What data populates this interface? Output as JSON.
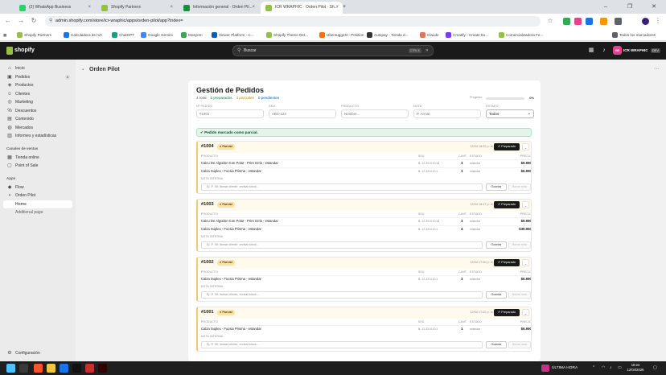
{
  "browser": {
    "tabs": [
      {
        "label": "(2) WhatsApp Business",
        "color": "#25d366"
      },
      {
        "label": "Shopify Partners",
        "color": "#95bf47"
      },
      {
        "label": "Información general · Orden Pil...",
        "color": "#1a8f3c"
      },
      {
        "label": "ICR WRAPHIC · Orden Pilot · Sh...",
        "color": "#95bf47"
      }
    ],
    "new_tab": "+",
    "url": "admin.shopify.com/store/icr-wraphic/apps/orden-pilot/app?index=",
    "bookmarks": [
      {
        "label": "Shopify Partners",
        "color": "#95bf47"
      },
      {
        "label": "Calculadora de IVA",
        "color": "#1a73e8"
      },
      {
        "label": "ChatGPT",
        "color": "#10a37f"
      },
      {
        "label": "Google Gemini",
        "color": "#4285f4"
      },
      {
        "label": "Mosyren",
        "color": "#34a853"
      },
      {
        "label": "Viewer Platform - A...",
        "color": "#0b5cad"
      },
      {
        "label": "Shopify Theme Det...",
        "color": "#95bf47"
      },
      {
        "label": "Ubersuggest - Position",
        "color": "#ff6f00"
      },
      {
        "label": "Autopay - Tienda d...",
        "color": "#333333"
      },
      {
        "label": "Claude",
        "color": "#d97757"
      },
      {
        "label": "Creatify - Create Ex...",
        "color": "#7c3aed"
      },
      {
        "label": "Comercializadora Fe...",
        "color": "#95bf47"
      }
    ],
    "all_bookmarks": "Todos los marcadores"
  },
  "topbar": {
    "logo": "shopify",
    "search_placeholder": "Buscar",
    "search_shortcut": "CTRL K",
    "store_initials": "IW",
    "store_name": "ICR WRAPHIC",
    "store_tag": "DEV"
  },
  "sidebar": {
    "items": [
      {
        "label": "Inicio",
        "icon": "home-icon",
        "glyph": "⌂"
      },
      {
        "label": "Pedidos",
        "icon": "inbox-icon",
        "glyph": "▣",
        "count": "4"
      },
      {
        "label": "Productos",
        "icon": "tag-icon",
        "glyph": "◈"
      },
      {
        "label": "Clientes",
        "icon": "person-icon",
        "glyph": "☺"
      },
      {
        "label": "Marketing",
        "icon": "target-icon",
        "glyph": "◎"
      },
      {
        "label": "Descuentos",
        "icon": "discount-icon",
        "glyph": "%"
      },
      {
        "label": "Contenido",
        "icon": "content-icon",
        "glyph": "▤"
      },
      {
        "label": "Mercados",
        "icon": "globe-icon",
        "glyph": "◍"
      },
      {
        "label": "Informes y estadísticas",
        "icon": "chart-icon",
        "glyph": "▥"
      }
    ],
    "channels_head": "Canales de ventas",
    "channels": [
      {
        "label": "Tienda online",
        "icon": "store-icon",
        "glyph": "▦"
      },
      {
        "label": "Point of Sale",
        "icon": "pos-icon",
        "glyph": "▢"
      }
    ],
    "apps_head": "Apps",
    "apps": [
      {
        "label": "Flow",
        "icon": "flow-icon",
        "glyph": "◆"
      },
      {
        "label": "Orden Pilot",
        "icon": "app-icon",
        "glyph": "▪"
      }
    ],
    "app_sub": [
      {
        "label": "Home"
      },
      {
        "label": "Additional page"
      }
    ],
    "settings": {
      "label": "Configuración",
      "icon": "gear-icon",
      "glyph": "⚙"
    }
  },
  "app": {
    "title": "Orden Pilot",
    "heading": "Gestión de Pedidos",
    "stats": [
      {
        "label": "4 total",
        "color": "#616161"
      },
      {
        "label": "0 preparados",
        "color": "#0c7a43"
      },
      {
        "label": "4 parciales",
        "color": "#b98900"
      },
      {
        "label": "0 pendientes",
        "color": "#005bd3"
      }
    ],
    "progress_label": "Progreso",
    "progress": 0,
    "progress_text": "0%",
    "filters": {
      "order_label": "Nº PEDIDO",
      "order_placeholder": "#1001",
      "sku_label": "SKU",
      "sku_placeholder": "ABC-123",
      "product_label": "PRODUCTO",
      "product_placeholder": "Nombre...",
      "note_label": "NOTA",
      "note_placeholder": "P. Armar",
      "status_label": "ESTADO",
      "status_value": "Todos"
    },
    "banner": "✔ Pedido marcado como parcial.",
    "col_product": "PRODUCTO",
    "col_sku": "SKU",
    "col_qty": "CANT.",
    "col_status": "ESTADO",
    "col_price": "PRECIO",
    "note_heading": "NOTA INTERNA",
    "note_placeholder": "Ej. P. 35: llamar cliente, revisar stock...",
    "save_label": "Guardar",
    "clear_label": "Borrar nota",
    "prep_label": "✔ Preparado",
    "more_label": "⌄",
    "orders": [
      {
        "id": "#1004",
        "badge": "● Parcial",
        "date": "12/04 18:22 p. m.",
        "items": [
          {
            "name": "Calcu De Algodon Con Polar - Print Grris - estandar",
            "sku": "B- 12-30-N-10-34",
            "qty": "1",
            "status": "estandar",
            "price": "$9.990"
          },
          {
            "name": "Calza Suplex - Fucsia Prisma - estandar",
            "sku": "B- 12-33-N-10-1",
            "qty": "1",
            "status": "estandar",
            "price": "$6.990"
          }
        ]
      },
      {
        "id": "#1003",
        "badge": "● Parcial",
        "date": "12/04 18:17 p. m.",
        "items": [
          {
            "name": "Calcu De Algodon Con Polar - Print Grris - estandar",
            "sku": "B- 12-30-N-10-34",
            "qty": "1",
            "status": "estandar",
            "price": "$9.990"
          },
          {
            "name": "Calza Suplex - Fucsia Prisma - estandar",
            "sku": "B- 12-33-N-10-1",
            "qty": "4",
            "status": "estandar",
            "price": "$39.960"
          }
        ]
      },
      {
        "id": "#1002",
        "badge": "● Parcial",
        "date": "12/04 17:30 p. m.",
        "items": [
          {
            "name": "Calza Suplex - Fucsia Prisma - estandar",
            "sku": "B- 12-33-N-10-1",
            "qty": "1",
            "status": "estandar",
            "price": "$6.990"
          }
        ]
      },
      {
        "id": "#1001",
        "badge": "● Parcial",
        "date": "12/04 17:22 p. m.",
        "items": [
          {
            "name": "Calza Suplex - Fucsia Prisma - estandar",
            "sku": "B- 12-33-N-10-1",
            "qty": "1",
            "status": "estandar",
            "price": "$6.990"
          }
        ]
      }
    ]
  },
  "taskbar": {
    "apps": [
      {
        "name": "brave-icon",
        "color": "#fb542b"
      },
      {
        "name": "files-icon",
        "color": "#f4c542"
      },
      {
        "name": "chrome-icon",
        "color": "#1a73e8"
      },
      {
        "name": "capcut-icon",
        "color": "#111111"
      },
      {
        "name": "app-red-icon",
        "color": "#c8302e"
      },
      {
        "name": "illustrator-icon",
        "color": "#330000"
      }
    ],
    "news": "ÚLTIMA HORA",
    "time": "18:24",
    "date": "12/04/2026"
  },
  "colors": {
    "accent": "#1a1a1a",
    "partial": "#f1c96b",
    "success": "#0c5132"
  }
}
